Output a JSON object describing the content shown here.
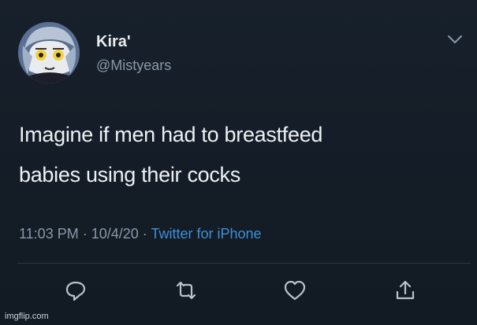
{
  "tweet": {
    "author": {
      "display_name": "Kira'",
      "handle": "@Mistyears",
      "avatar_icon": "anime-avatar"
    },
    "text_lines": [
      "Imagine if men had to breastfeed",
      "babies using their cocks"
    ],
    "meta": {
      "time": "11:03 PM",
      "separator": " · ",
      "date": "10/4/20",
      "source": "Twitter for iPhone"
    },
    "actions": [
      {
        "icon": "reply-icon"
      },
      {
        "icon": "retweet-icon"
      },
      {
        "icon": "like-icon"
      },
      {
        "icon": "share-icon"
      }
    ]
  },
  "watermark": "imgflip.com",
  "colors": {
    "background": "#141c26",
    "text": "#eef1f4",
    "secondary": "#8a98a8",
    "link": "#3f8fd6"
  }
}
